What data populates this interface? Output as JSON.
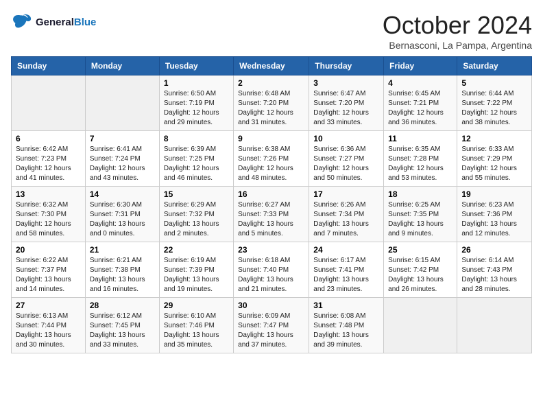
{
  "logo": {
    "line1": "General",
    "line2": "Blue"
  },
  "title": "October 2024",
  "location": "Bernasconi, La Pampa, Argentina",
  "days_of_week": [
    "Sunday",
    "Monday",
    "Tuesday",
    "Wednesday",
    "Thursday",
    "Friday",
    "Saturday"
  ],
  "weeks": [
    [
      {
        "num": "",
        "info": ""
      },
      {
        "num": "",
        "info": ""
      },
      {
        "num": "1",
        "info": "Sunrise: 6:50 AM\nSunset: 7:19 PM\nDaylight: 12 hours\nand 29 minutes."
      },
      {
        "num": "2",
        "info": "Sunrise: 6:48 AM\nSunset: 7:20 PM\nDaylight: 12 hours\nand 31 minutes."
      },
      {
        "num": "3",
        "info": "Sunrise: 6:47 AM\nSunset: 7:20 PM\nDaylight: 12 hours\nand 33 minutes."
      },
      {
        "num": "4",
        "info": "Sunrise: 6:45 AM\nSunset: 7:21 PM\nDaylight: 12 hours\nand 36 minutes."
      },
      {
        "num": "5",
        "info": "Sunrise: 6:44 AM\nSunset: 7:22 PM\nDaylight: 12 hours\nand 38 minutes."
      }
    ],
    [
      {
        "num": "6",
        "info": "Sunrise: 6:42 AM\nSunset: 7:23 PM\nDaylight: 12 hours\nand 41 minutes."
      },
      {
        "num": "7",
        "info": "Sunrise: 6:41 AM\nSunset: 7:24 PM\nDaylight: 12 hours\nand 43 minutes."
      },
      {
        "num": "8",
        "info": "Sunrise: 6:39 AM\nSunset: 7:25 PM\nDaylight: 12 hours\nand 46 minutes."
      },
      {
        "num": "9",
        "info": "Sunrise: 6:38 AM\nSunset: 7:26 PM\nDaylight: 12 hours\nand 48 minutes."
      },
      {
        "num": "10",
        "info": "Sunrise: 6:36 AM\nSunset: 7:27 PM\nDaylight: 12 hours\nand 50 minutes."
      },
      {
        "num": "11",
        "info": "Sunrise: 6:35 AM\nSunset: 7:28 PM\nDaylight: 12 hours\nand 53 minutes."
      },
      {
        "num": "12",
        "info": "Sunrise: 6:33 AM\nSunset: 7:29 PM\nDaylight: 12 hours\nand 55 minutes."
      }
    ],
    [
      {
        "num": "13",
        "info": "Sunrise: 6:32 AM\nSunset: 7:30 PM\nDaylight: 12 hours\nand 58 minutes."
      },
      {
        "num": "14",
        "info": "Sunrise: 6:30 AM\nSunset: 7:31 PM\nDaylight: 13 hours\nand 0 minutes."
      },
      {
        "num": "15",
        "info": "Sunrise: 6:29 AM\nSunset: 7:32 PM\nDaylight: 13 hours\nand 2 minutes."
      },
      {
        "num": "16",
        "info": "Sunrise: 6:27 AM\nSunset: 7:33 PM\nDaylight: 13 hours\nand 5 minutes."
      },
      {
        "num": "17",
        "info": "Sunrise: 6:26 AM\nSunset: 7:34 PM\nDaylight: 13 hours\nand 7 minutes."
      },
      {
        "num": "18",
        "info": "Sunrise: 6:25 AM\nSunset: 7:35 PM\nDaylight: 13 hours\nand 9 minutes."
      },
      {
        "num": "19",
        "info": "Sunrise: 6:23 AM\nSunset: 7:36 PM\nDaylight: 13 hours\nand 12 minutes."
      }
    ],
    [
      {
        "num": "20",
        "info": "Sunrise: 6:22 AM\nSunset: 7:37 PM\nDaylight: 13 hours\nand 14 minutes."
      },
      {
        "num": "21",
        "info": "Sunrise: 6:21 AM\nSunset: 7:38 PM\nDaylight: 13 hours\nand 16 minutes."
      },
      {
        "num": "22",
        "info": "Sunrise: 6:19 AM\nSunset: 7:39 PM\nDaylight: 13 hours\nand 19 minutes."
      },
      {
        "num": "23",
        "info": "Sunrise: 6:18 AM\nSunset: 7:40 PM\nDaylight: 13 hours\nand 21 minutes."
      },
      {
        "num": "24",
        "info": "Sunrise: 6:17 AM\nSunset: 7:41 PM\nDaylight: 13 hours\nand 23 minutes."
      },
      {
        "num": "25",
        "info": "Sunrise: 6:15 AM\nSunset: 7:42 PM\nDaylight: 13 hours\nand 26 minutes."
      },
      {
        "num": "26",
        "info": "Sunrise: 6:14 AM\nSunset: 7:43 PM\nDaylight: 13 hours\nand 28 minutes."
      }
    ],
    [
      {
        "num": "27",
        "info": "Sunrise: 6:13 AM\nSunset: 7:44 PM\nDaylight: 13 hours\nand 30 minutes."
      },
      {
        "num": "28",
        "info": "Sunrise: 6:12 AM\nSunset: 7:45 PM\nDaylight: 13 hours\nand 33 minutes."
      },
      {
        "num": "29",
        "info": "Sunrise: 6:10 AM\nSunset: 7:46 PM\nDaylight: 13 hours\nand 35 minutes."
      },
      {
        "num": "30",
        "info": "Sunrise: 6:09 AM\nSunset: 7:47 PM\nDaylight: 13 hours\nand 37 minutes."
      },
      {
        "num": "31",
        "info": "Sunrise: 6:08 AM\nSunset: 7:48 PM\nDaylight: 13 hours\nand 39 minutes."
      },
      {
        "num": "",
        "info": ""
      },
      {
        "num": "",
        "info": ""
      }
    ]
  ]
}
